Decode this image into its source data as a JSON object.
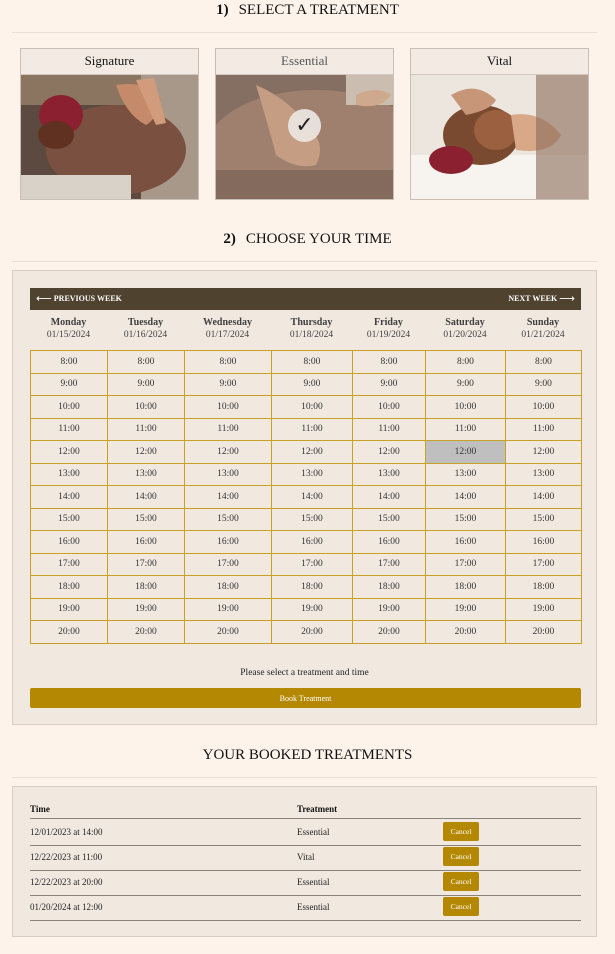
{
  "section1": {
    "num": "1)",
    "title": "SELECT A TREATMENT"
  },
  "treatments": [
    {
      "name": "Signature",
      "selected": false
    },
    {
      "name": "Essential",
      "selected": true
    },
    {
      "name": "Vital",
      "selected": false
    }
  ],
  "section2": {
    "num": "2)",
    "title": "CHOOSE YOUR TIME"
  },
  "calendar": {
    "prev_label": "PREVIOUS WEEK",
    "next_label": "NEXT WEEK",
    "days": [
      {
        "name": "Monday",
        "date": "01/15/2024"
      },
      {
        "name": "Tuesday",
        "date": "01/16/2024"
      },
      {
        "name": "Wednesday",
        "date": "01/17/2024"
      },
      {
        "name": "Thursday",
        "date": "01/18/2024"
      },
      {
        "name": "Friday",
        "date": "01/19/2024"
      },
      {
        "name": "Saturday",
        "date": "01/20/2024"
      },
      {
        "name": "Sunday",
        "date": "01/21/2024"
      }
    ],
    "times": [
      "8:00",
      "9:00",
      "10:00",
      "11:00",
      "12:00",
      "13:00",
      "14:00",
      "15:00",
      "16:00",
      "17:00",
      "18:00",
      "19:00",
      "20:00"
    ],
    "selected_slot": {
      "day": "Saturday",
      "time": "12:00"
    },
    "status_message": "Please select a treatment and time",
    "book_label": "Book Treatment"
  },
  "bookings": {
    "title": "YOUR BOOKED TREATMENTS",
    "col_time": "Time",
    "col_treatment": "Treatment",
    "cancel_label": "Cancel",
    "rows": [
      {
        "time": "12/01/2023 at 14:00",
        "treatment": "Essential"
      },
      {
        "time": "12/22/2023 at 11:00",
        "treatment": "Vital"
      },
      {
        "time": "12/22/2023 at 20:00",
        "treatment": "Essential"
      },
      {
        "time": "01/20/2024 at 12:00",
        "treatment": "Essential"
      }
    ]
  },
  "colors": {
    "accent": "#b48803",
    "week_bar": "#4f4330",
    "grid_border": "#c9a021",
    "background": "#fdf3ea",
    "panel": "#f1e8e0",
    "selected_slot": "#bfbfbf"
  },
  "icons": {
    "prev": "arrow-left-icon",
    "next": "arrow-right-icon",
    "selected": "check-icon"
  }
}
